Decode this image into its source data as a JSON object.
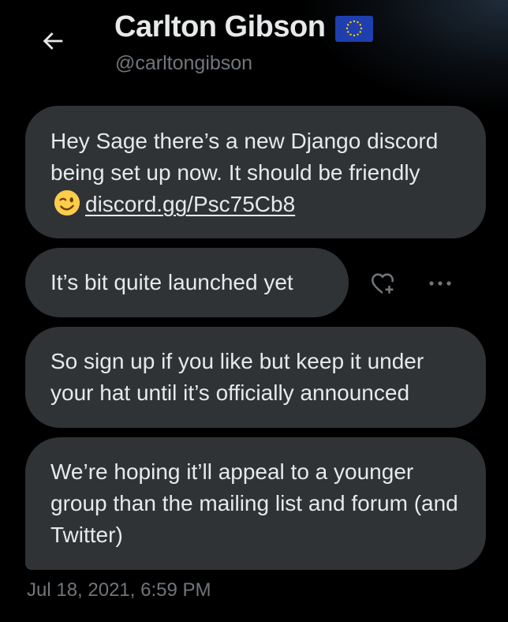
{
  "header": {
    "back_icon": "arrow-left-icon",
    "display_name": "Carlton Gibson",
    "flag_icon": "eu-flag-icon",
    "handle": "@carltongibson"
  },
  "messages": [
    {
      "text_before": "Hey Sage there’s a new Django discord being set up now. It should be friendly",
      "emoji": "winking-face-icon",
      "link_text": "discord.gg/Psc75Cb8"
    },
    {
      "text": "It’s bit quite launched yet"
    },
    {
      "text": "So sign up if you like but keep it under your hat until it’s officially announced"
    },
    {
      "text": "We’re hoping it’ll appeal to a younger group than the mailing list and forum (and Twitter)"
    }
  ],
  "actions": {
    "react_icon": "add-reaction-icon",
    "more_icon": "more-horizontal-icon"
  },
  "timestamp": "Jul 18, 2021, 6:59 PM",
  "colors": {
    "background": "#000000",
    "bubble": "#2f3336",
    "text_primary": "#e7e9ea",
    "text_secondary": "#71767b",
    "flag_blue": "#1f3fae",
    "flag_star": "#ffd400"
  }
}
